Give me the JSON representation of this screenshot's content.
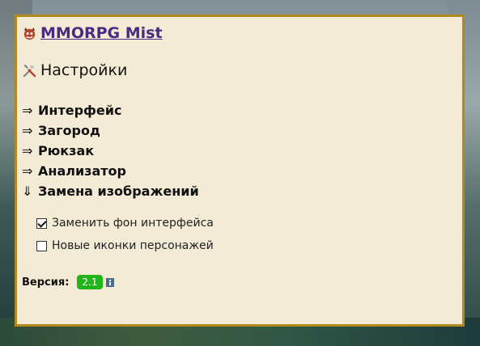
{
  "header": {
    "title": "MMORPG Mist",
    "icon": "demon-icon"
  },
  "section": {
    "title": "Настройки",
    "icon": "tools-icon"
  },
  "menu": [
    {
      "arrow": "⇒",
      "label": "Интерфейс"
    },
    {
      "arrow": "⇒",
      "label": "Загород"
    },
    {
      "arrow": "⇒",
      "label": "Рюкзак"
    },
    {
      "arrow": "⇒",
      "label": "Анализатор"
    },
    {
      "arrow": "⇓",
      "label": "Замена изображений"
    }
  ],
  "options": [
    {
      "label": "Заменить фон интерфейса",
      "checked": true
    },
    {
      "label": "Новые иконки персонажей",
      "checked": false
    }
  ],
  "version": {
    "label": "Версия:",
    "value": "2.1"
  },
  "colors": {
    "panel_bg": "#f3ebd5",
    "panel_border": "#b08a1c",
    "title_link": "#4b2a84",
    "version_badge": "#21b51b"
  }
}
